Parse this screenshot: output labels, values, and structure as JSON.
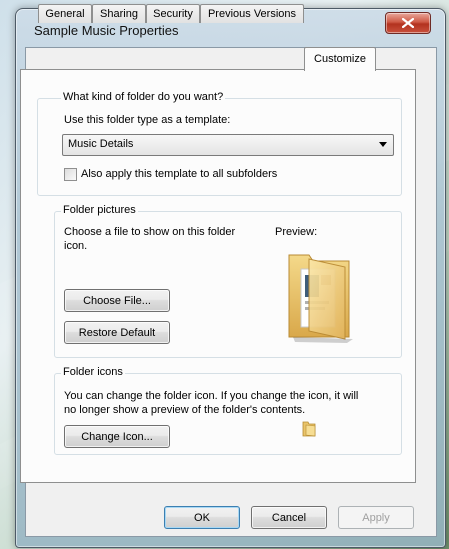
{
  "window": {
    "title": "Sample Music Properties",
    "close_label": "X"
  },
  "tabs": [
    {
      "label": "General"
    },
    {
      "label": "Sharing"
    },
    {
      "label": "Security"
    },
    {
      "label": "Previous Versions"
    },
    {
      "label": "Customize",
      "active": true
    }
  ],
  "folder_type": {
    "legend": "What kind of folder do you want?",
    "template_label": "Use this folder type as a template:",
    "selected": "Music Details",
    "apply_subfolders_label": "Also apply this template to all subfolders",
    "apply_subfolders_checked": false
  },
  "folder_pictures": {
    "legend": "Folder pictures",
    "description_line1": "Choose a file to show on this folder",
    "description_line2": "icon.",
    "preview_label": "Preview:",
    "choose_file_label": "Choose File...",
    "restore_default_label": "Restore Default"
  },
  "folder_icons": {
    "legend": "Folder icons",
    "description_line1": "You can change the folder icon. If you change the icon, it will",
    "description_line2": "no longer show a preview of the folder's contents.",
    "change_icon_label": "Change Icon..."
  },
  "footer": {
    "ok_label": "OK",
    "cancel_label": "Cancel",
    "apply_label": "Apply"
  },
  "icons": {
    "close": "close-icon",
    "dropdown": "chevron-down-icon",
    "preview": "folder-preview-icon",
    "folder_small": "folder-icon"
  },
  "colors": {
    "close_button": "#c9513d",
    "default_button_border": "#3c7fb1",
    "panel_background": "#fcfcfc"
  }
}
